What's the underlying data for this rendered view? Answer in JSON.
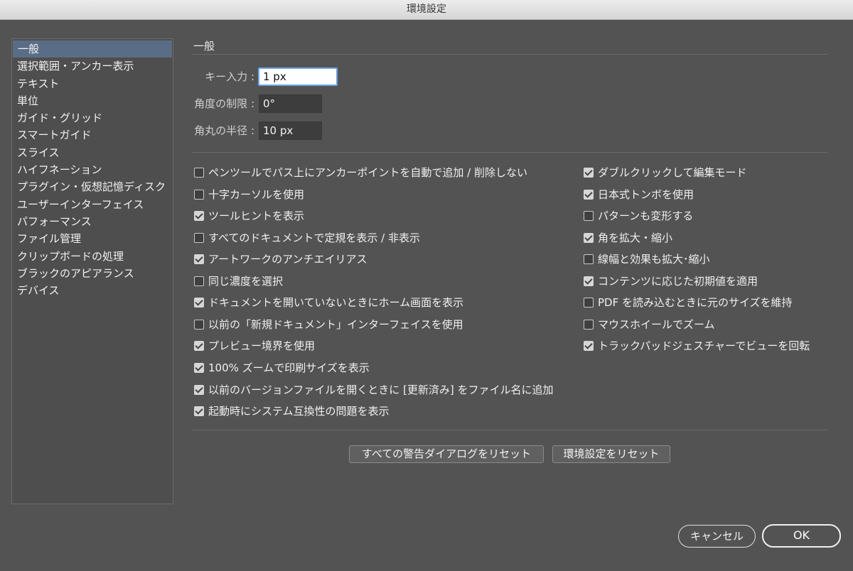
{
  "window": {
    "title": "環境設定"
  },
  "sidebar": {
    "items": [
      {
        "label": "一般",
        "selected": true
      },
      {
        "label": "選択範囲・アンカー表示",
        "selected": false
      },
      {
        "label": "テキスト",
        "selected": false
      },
      {
        "label": "単位",
        "selected": false
      },
      {
        "label": "ガイド・グリッド",
        "selected": false
      },
      {
        "label": "スマートガイド",
        "selected": false
      },
      {
        "label": "スライス",
        "selected": false
      },
      {
        "label": "ハイフネーション",
        "selected": false
      },
      {
        "label": "プラグイン・仮想記憶ディスク",
        "selected": false
      },
      {
        "label": "ユーザーインターフェイス",
        "selected": false
      },
      {
        "label": "パフォーマンス",
        "selected": false
      },
      {
        "label": "ファイル管理",
        "selected": false
      },
      {
        "label": "クリップボードの処理",
        "selected": false
      },
      {
        "label": "ブラックのアピアランス",
        "selected": false
      },
      {
        "label": "デバイス",
        "selected": false
      }
    ]
  },
  "main": {
    "section_title": "一般",
    "fields": {
      "keyboard_increment": {
        "label": "キー入力 :",
        "value": "1 px"
      },
      "constrain_angle": {
        "label": "角度の制限 :",
        "value": "0°"
      },
      "corner_radius": {
        "label": "角丸の半径 :",
        "value": "10 px"
      }
    },
    "left_checks": [
      {
        "label": "ペンツールでパス上にアンカーポイントを自動で追加 / 削除しない",
        "checked": false
      },
      {
        "label": "十字カーソルを使用",
        "checked": false
      },
      {
        "label": "ツールヒントを表示",
        "checked": true
      },
      {
        "label": "すべてのドキュメントで定規を表示 / 非表示",
        "checked": false
      },
      {
        "label": "アートワークのアンチエイリアス",
        "checked": true
      },
      {
        "label": "同じ濃度を選択",
        "checked": false
      },
      {
        "label": "ドキュメントを開いていないときにホーム画面を表示",
        "checked": true
      },
      {
        "label": "以前の「新規ドキュメント」インターフェイスを使用",
        "checked": false
      },
      {
        "label": "プレビュー境界を使用",
        "checked": true
      },
      {
        "label": "100% ズームで印刷サイズを表示",
        "checked": true
      },
      {
        "label": "以前のバージョンファイルを開くときに [更新済み] をファイル名に追加",
        "checked": true
      },
      {
        "label": "起動時にシステム互換性の問題を表示",
        "checked": true
      }
    ],
    "right_checks": [
      {
        "label": "ダブルクリックして編集モード",
        "checked": true
      },
      {
        "label": "日本式トンボを使用",
        "checked": true
      },
      {
        "label": "パターンも変形する",
        "checked": false
      },
      {
        "label": "角を拡大・縮小",
        "checked": true
      },
      {
        "label": "線幅と効果も拡大･縮小",
        "checked": false
      },
      {
        "label": "コンテンツに応じた初期値を適用",
        "checked": true
      },
      {
        "label": "PDF を読み込むときに元のサイズを維持",
        "checked": false
      },
      {
        "label": "マウスホイールでズーム",
        "checked": false
      },
      {
        "label": "トラックパッドジェスチャーでビューを回転",
        "checked": true
      }
    ],
    "buttons": {
      "reset_warnings": "すべての警告ダイアログをリセット",
      "reset_preferences": "環境設定をリセット"
    }
  },
  "footer": {
    "cancel": "キャンセル",
    "ok": "OK"
  }
}
